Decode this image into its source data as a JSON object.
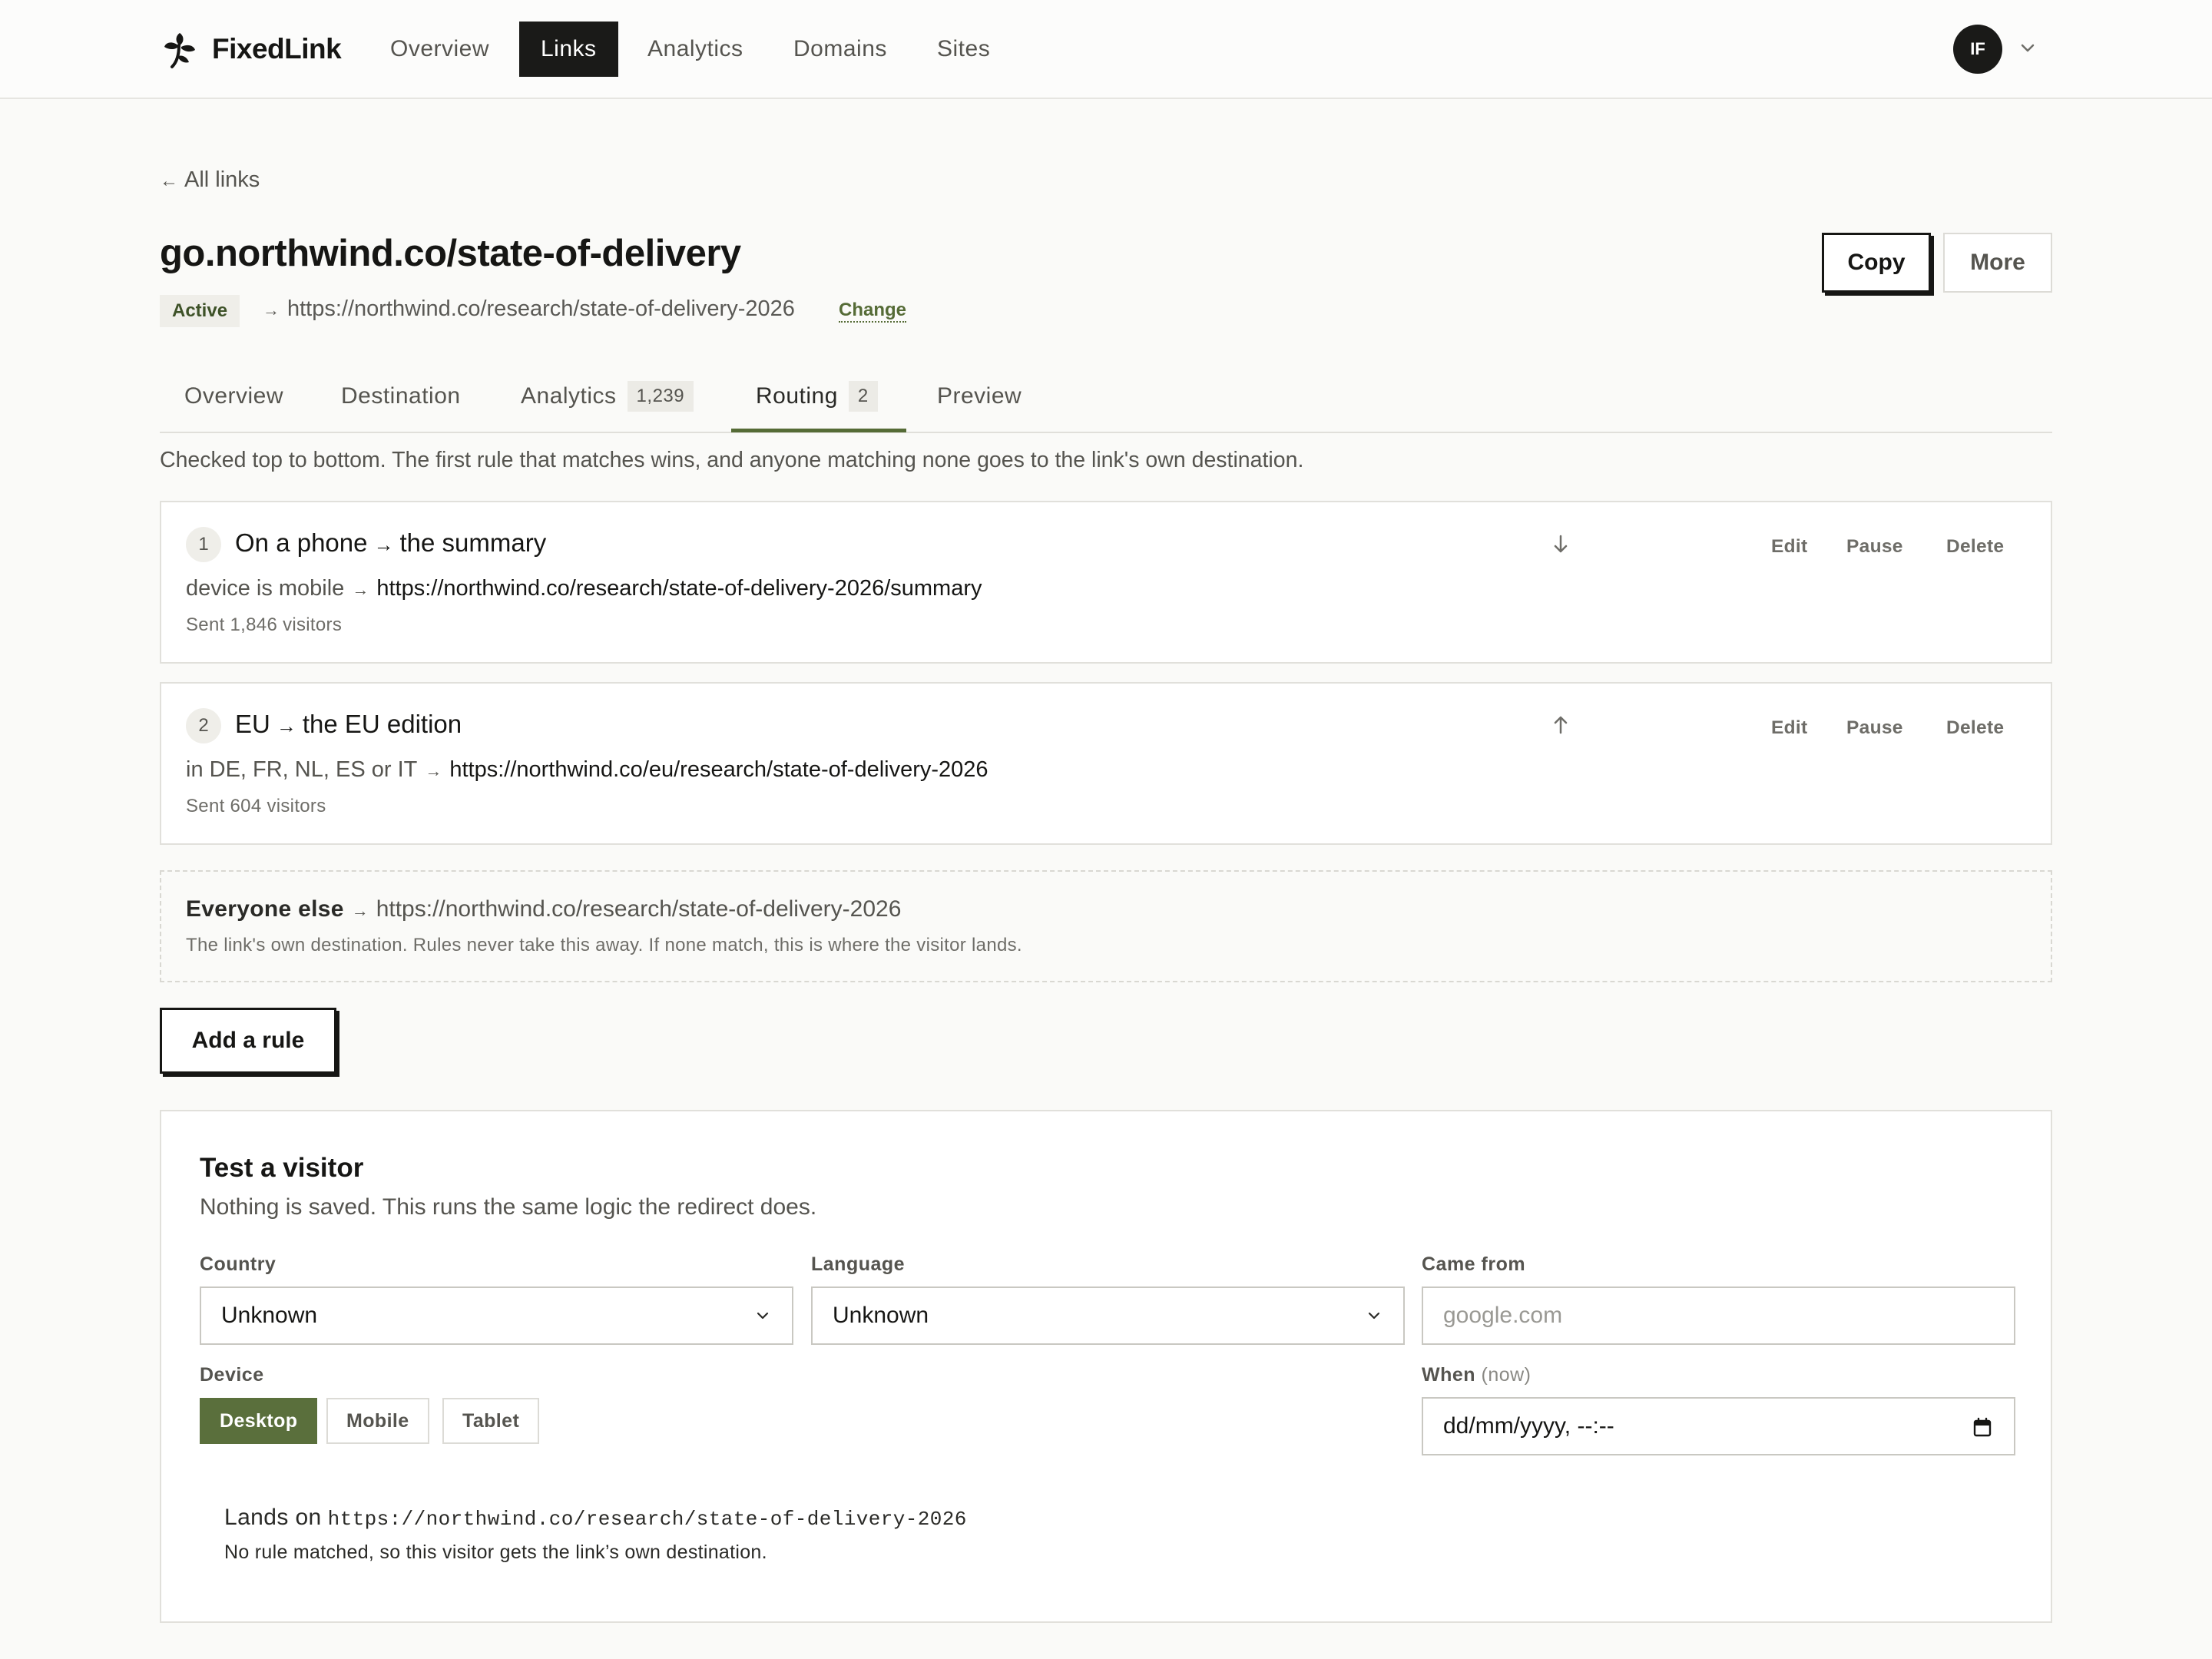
{
  "app": {
    "name": "FixedLink"
  },
  "nav": {
    "items": [
      {
        "label": "Overview",
        "active": false
      },
      {
        "label": "Links",
        "active": true
      },
      {
        "label": "Analytics",
        "active": false
      },
      {
        "label": "Domains",
        "active": false
      },
      {
        "label": "Sites",
        "active": false
      }
    ],
    "avatar_initials": "IF"
  },
  "header": {
    "back_label": "All links",
    "short_link": "go.northwind.co/state-of-delivery",
    "status": "Active",
    "destination": "https://northwind.co/research/state-of-delivery-2026",
    "change_label": "Change",
    "copy_label": "Copy",
    "more_label": "More"
  },
  "tabs": [
    {
      "label": "Overview"
    },
    {
      "label": "Destination"
    },
    {
      "label": "Analytics",
      "count": "1,239"
    },
    {
      "label": "Routing",
      "count": "2",
      "active": true
    },
    {
      "label": "Preview"
    }
  ],
  "routing": {
    "intro": "Checked top to bottom. The first rule that matches wins, and anyone matching none goes to the link's own destination.",
    "rules": [
      {
        "number": "1",
        "condition_name": "On a phone",
        "target_name": "the summary",
        "condition": "device is mobile",
        "url": "https://northwind.co/research/state-of-delivery-2026/summary",
        "sent": "Sent 1,846 visitors",
        "move": "move-down"
      },
      {
        "number": "2",
        "condition_name": "EU",
        "target_name": "the EU edition",
        "condition": "in DE, FR, NL, ES or IT",
        "url": "https://northwind.co/eu/research/state-of-delivery-2026",
        "sent": "Sent 604 visitors",
        "move": "move-up"
      }
    ],
    "actions": {
      "edit": "Edit",
      "pause": "Pause",
      "delete": "Delete"
    },
    "fallback": {
      "title": "Everyone else",
      "url": "https://northwind.co/research/state-of-delivery-2026",
      "note": "The link's own destination. Rules never take this away. If none match, this is where the visitor lands."
    },
    "add_rule_label": "Add a rule"
  },
  "test": {
    "title": "Test a visitor",
    "subtitle": "Nothing is saved. This runs the same logic the redirect does.",
    "country": {
      "label": "Country",
      "value": "Unknown"
    },
    "language": {
      "label": "Language",
      "value": "Unknown"
    },
    "came_from": {
      "label": "Came from",
      "placeholder": "google.com"
    },
    "device": {
      "label": "Device",
      "options": [
        "Desktop",
        "Mobile",
        "Tablet"
      ],
      "selected": "Desktop"
    },
    "when": {
      "label": "When",
      "hint": "(now)",
      "value": "dd/mm/yyyy, --:--"
    },
    "result": {
      "label": "Lands on",
      "url": "https://northwind.co/research/state-of-delivery-2026",
      "note": "No rule matched, so this visitor gets the link’s own destination."
    }
  },
  "colors": {
    "accent": "#556b36",
    "accent_button": "#5a6f3c",
    "ink": "#161614",
    "background": "#fafaf8"
  },
  "icons": [
    "brand-leaf-icon",
    "chevron-down-icon",
    "arrow-left-icon",
    "arrow-right-icon",
    "arrow-down-icon",
    "arrow-up-icon",
    "calendar-icon"
  ]
}
